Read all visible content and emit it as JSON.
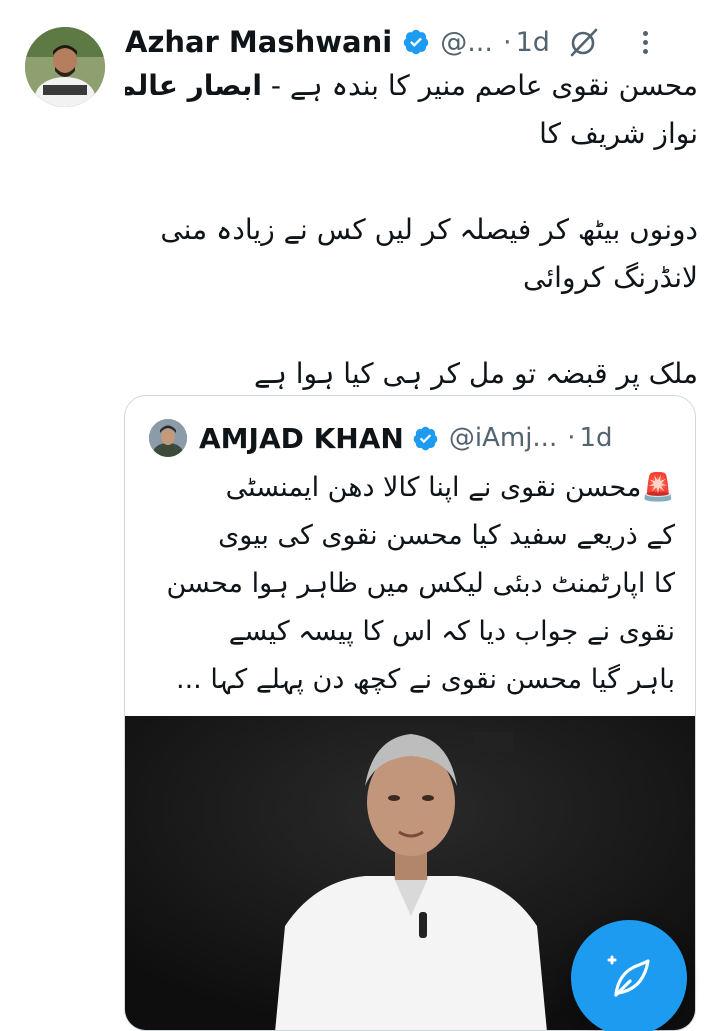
{
  "tweet": {
    "author_name": "Azhar Mashwani",
    "handle": "@...",
    "separator": "·",
    "time": "1d",
    "lines": [
      "محسن نقوی عاصم منیر کا بندہ ہے - ",
      "ابصار عالم",
      "نواز شریف کا",
      "دونوں بیٹھ کر فیصلہ کر لیں کس نے زیادہ منی",
      "لانڈرنگ کروائی",
      "ملک پر قبضہ تو مل کر ہی کیا ہوا ہے"
    ]
  },
  "quote": {
    "author_name": "AMJAD KHAN",
    "handle": "@iAmj...",
    "separator": "·",
    "time": "1d",
    "emoji": "🚨",
    "lines": [
      "محسن نقوی نے اپنا کالا دھن ایمنسٹی",
      "کے ذریعے سفید کیا محسن نقوی کی بیوی",
      "کا اپارٹمنٹ دبئی لیکس میں ظاہر ہوا محسن",
      "نقوی نے جواب دیا کہ اس کا پیسہ کیسے",
      "باہر گیا محسن نقوی نے کچھ دن پہلے کہا ..."
    ]
  },
  "colors": {
    "accent": "#1d9bf0",
    "secondary_text": "#536471",
    "border": "#cfd9de"
  },
  "icons": {
    "verified": "verified-badge-icon",
    "grok": "grok-icon",
    "more": "more-vertical-icon",
    "compose": "compose-post-icon"
  }
}
